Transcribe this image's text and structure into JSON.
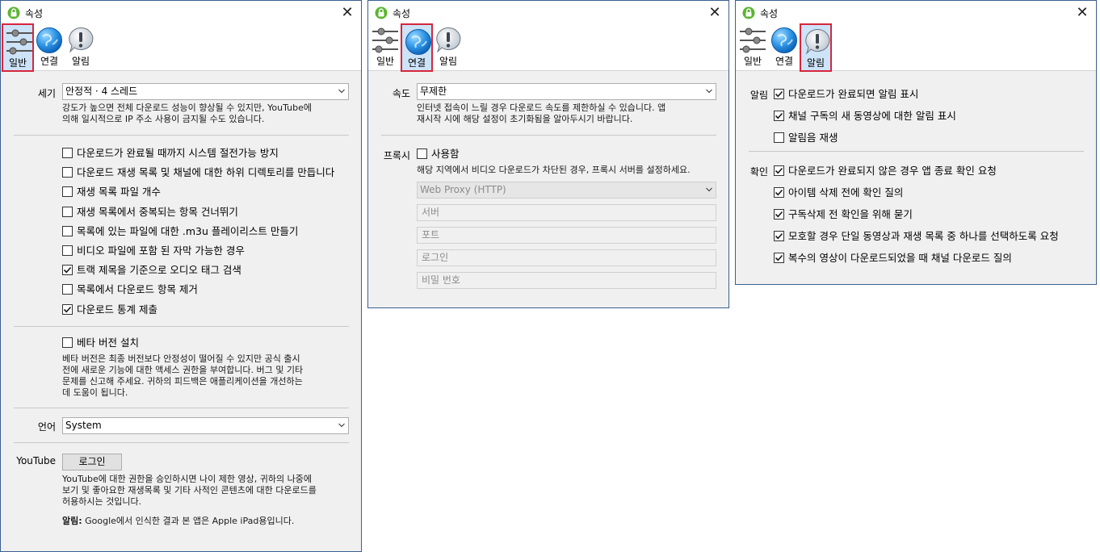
{
  "app": {
    "title": "속성"
  },
  "tabs": {
    "general": "일반",
    "connection": "연결",
    "notifications": "알림"
  },
  "general": {
    "size_label": "세기",
    "size_value": "안정적 · 4 스레드",
    "size_desc": [
      "강도가 높으면 전체 다운로드 성능이 향상될 수 있지만, YouTube에",
      "의해 일시적으로 IP 주소 사용이 금지될 수도 있습니다."
    ],
    "options": [
      {
        "label": "다운로드가 완료될 때까지 시스템 절전가능 방지",
        "checked": false
      },
      {
        "label": "다운로드 재생 목록 및 채널에 대한 하위 디렉토리를 만듭니다",
        "checked": false
      },
      {
        "label": "재생 목록 파일 개수",
        "checked": false
      },
      {
        "label": "재생 목록에서 중복되는 항목 건너뛰기",
        "checked": false
      },
      {
        "label": "목록에 있는 파일에 대한 .m3u 플레이리스트 만들기",
        "checked": false
      },
      {
        "label": "비디오 파일에 포함 된 자막 가능한 경우",
        "checked": false
      },
      {
        "label": "트랙 제목을 기준으로 오디오 태그 검색",
        "checked": true
      },
      {
        "label": "목록에서 다운로드 항목 제거",
        "checked": false
      },
      {
        "label": "다운로드 통계 제출",
        "checked": true
      }
    ],
    "beta_label": "베타 버전 설치",
    "beta_checked": false,
    "beta_desc": [
      "베타 버전은 최종 버전보다 안정성이 떨어질 수 있지만 공식 출시",
      "전에 새로운 기능에 대한 액세스 권한을 부여합니다. 버그 및 기타",
      "문제를 신고해 주세요. 귀하의 피드백은 애플리케이션을 개선하는",
      "데 도움이 됩니다."
    ],
    "language_label": "언어",
    "language_value": "System",
    "youtube_label": "YouTube",
    "login_button": "로그인",
    "youtube_desc": [
      "YouTube에 대한 권한을 승인하시면 나이 제한 영상, 귀하의 나중에",
      "보기 및 좋아요한 재생목록 및 기타 사적인 콘텐츠에 대한 다운로드를",
      "허용하시는 것입니다."
    ],
    "notice_bold": "알림:",
    "notice_text": " Google에서 인식한 결과 본 앱은 Apple iPad용입니다."
  },
  "connection": {
    "speed_label": "속도",
    "speed_value": "무제한",
    "speed_desc": [
      "인터넷 접속이 느릴 경우 다운로드 속도를 제한하실 수 있습니다. 앱",
      "재시작 시에 해당 설정이 초기화됨을 알아두시기 바랍니다."
    ],
    "proxy_label": "프록시",
    "proxy_use_label": "사용함",
    "proxy_use_checked": false,
    "proxy_desc": "해당 지역에서 비디오 다운로드가 차단된 경우, 프록시 서버를 설정하세요.",
    "proxy_type": "Web Proxy (HTTP)",
    "server_placeholder": "서버",
    "port_placeholder": "포트",
    "login_placeholder": "로그인",
    "password_placeholder": "비밀 번호"
  },
  "notifications": {
    "notify_label": "알림",
    "notify_options": [
      {
        "label": "다운로드가 완료되면 알림 표시",
        "checked": true
      },
      {
        "label": "채널 구독의 새 동영상에 대한 알림 표시",
        "checked": true
      },
      {
        "label": "알림음 재생",
        "checked": false
      }
    ],
    "confirm_label": "확인",
    "confirm_options": [
      {
        "label": "다운로드가 완료되지 않은 경우 앱 종료 확인 요청",
        "checked": true
      },
      {
        "label": "아이템 삭제 전에 확인 질의",
        "checked": true
      },
      {
        "label": "구독삭제 전 확인을 위해 묻기",
        "checked": true
      },
      {
        "label": "모호할 경우 단일 동영상과 재생 목록 중 하나를 선택하도록 요청",
        "checked": true
      },
      {
        "label": "복수의 영상이 다운로드되었을 때 채널 다운로드 질의",
        "checked": true
      }
    ]
  }
}
